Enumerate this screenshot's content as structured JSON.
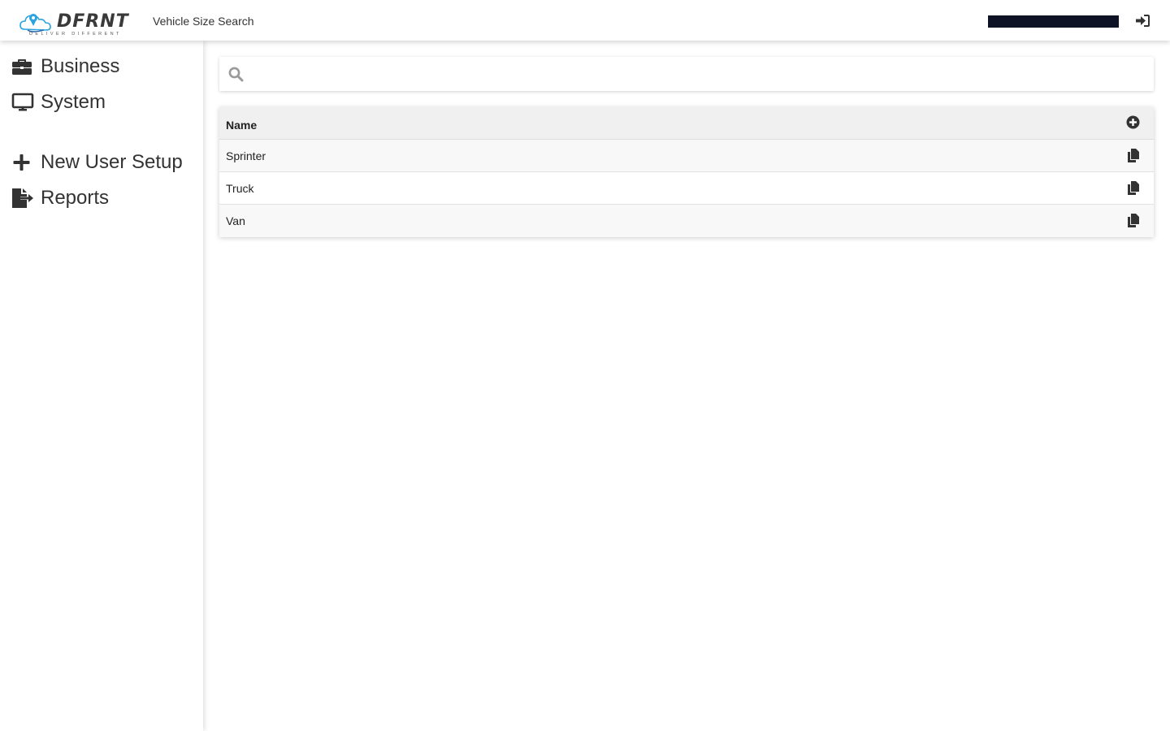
{
  "header": {
    "logo_text": "DFRNT",
    "logo_tagline": "DELIVER DIFFERENT",
    "page_title": "Vehicle Size Search",
    "login_icon": "sign-in-icon"
  },
  "sidebar": {
    "items": [
      {
        "label": "Business",
        "icon": "briefcase-icon"
      },
      {
        "label": "System",
        "icon": "monitor-icon"
      },
      {
        "label": "New User Setup",
        "icon": "plus-icon"
      },
      {
        "label": "Reports",
        "icon": "file-export-icon"
      }
    ]
  },
  "search": {
    "placeholder": "",
    "value": "",
    "icon": "search-icon"
  },
  "table": {
    "columns": [
      "Name"
    ],
    "add_icon": "plus-circle-icon",
    "row_action_icon": "copy-icon",
    "rows": [
      {
        "name": "Sprinter"
      },
      {
        "name": "Truck"
      },
      {
        "name": "Van"
      }
    ]
  },
  "colors": {
    "accent_blue": "#2aa3e0",
    "text_dark": "#333333",
    "user_box": "#0d1224",
    "header_row_bg": "#f0f0f0"
  }
}
